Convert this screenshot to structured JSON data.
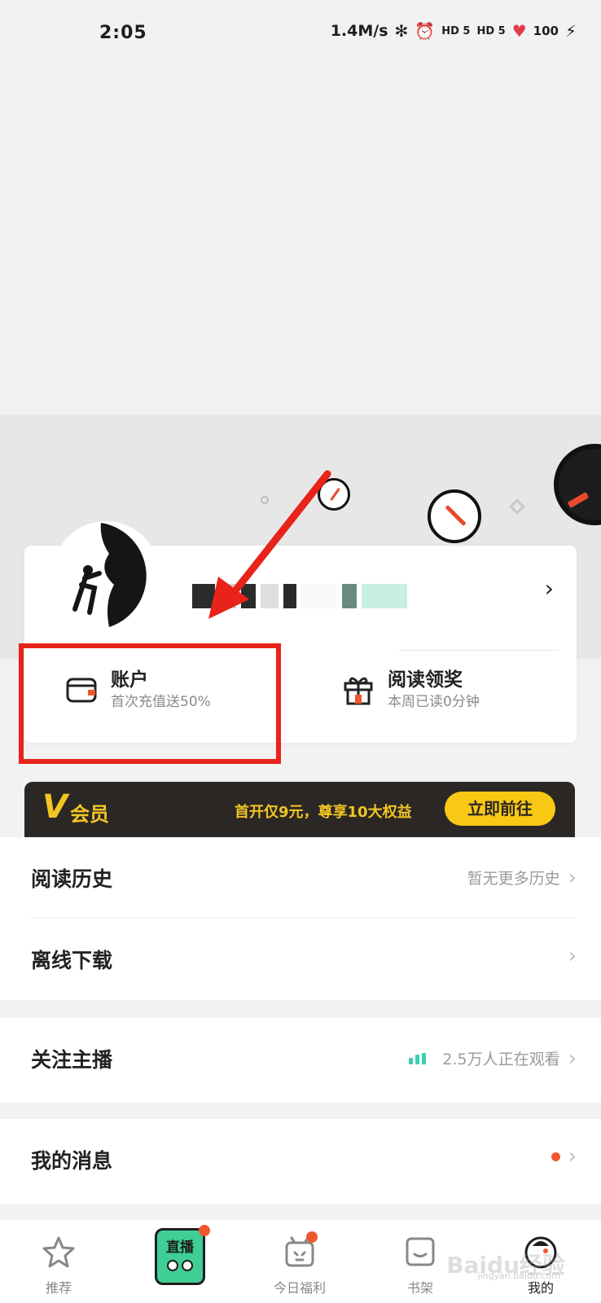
{
  "status": {
    "time": "2:05",
    "speed": "1.4M/s",
    "signal_1": "HD 5",
    "signal_2": "HD 5",
    "battery": "100"
  },
  "profile": {
    "chevron": "›"
  },
  "entries": {
    "account_title": "账户",
    "account_sub": "首次充值送50%",
    "reward_title": "阅读领奖",
    "reward_sub": "本周已读0分钟"
  },
  "vip": {
    "v_letter": "V",
    "label": "会员",
    "promo": "首开仅9元，尊享10大权益",
    "button": "立即前往",
    "accent_color": "#f3c623"
  },
  "menu": {
    "history_label": "阅读历史",
    "history_right": "暂无更多历史",
    "offline_label": "离线下载",
    "follow_label": "关注主播",
    "follow_right": "2.5万人正在观看",
    "messages_label": "我的消息"
  },
  "bottom_nav": {
    "recommend": "推荐",
    "live": "直播",
    "welfare": "今日福利",
    "shelf": "书架",
    "mine": "我的"
  },
  "colors": {
    "highlight": "#e8231a",
    "live_green": "#3ccfb1",
    "notify_dot": "#f0572f"
  },
  "watermark": {
    "brand": "Baidu经验",
    "url": "jingyan.baidu.com"
  }
}
